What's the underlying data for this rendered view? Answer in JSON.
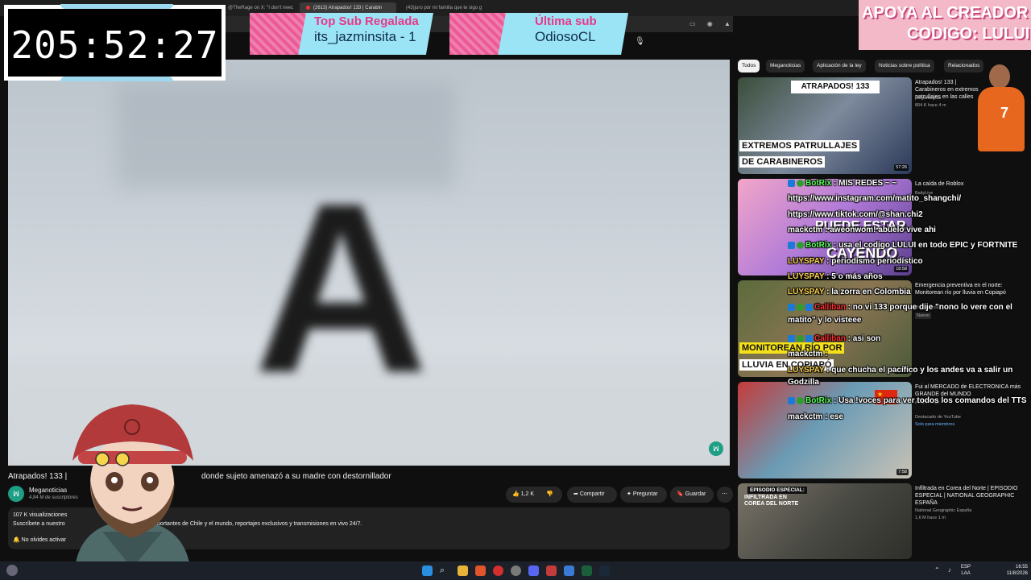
{
  "browser": {
    "tabs": [
      {
        "label": "@TheRage on X: \"I don't neec"
      },
      {
        "label": "(2613) Atrapados! 133 | Carabin"
      },
      {
        "label": "(43)juro por mi familia que te sigo g"
      }
    ]
  },
  "stream_overlay": {
    "timer": "205:52:27",
    "top_sub": {
      "heading": "Top Sub Regalada",
      "value": "its_jazminsita - 1"
    },
    "last_sub": {
      "heading": "Última sub",
      "value": "OdiosoCL"
    },
    "support": {
      "line1": "APOYA AL CREADOR",
      "line2": "CODIGO: LULUI"
    }
  },
  "video": {
    "title_start": "Atrapados! 133 |",
    "title_end": "donde sujeto amenazó a su madre con destornillador",
    "channel": "Meganoticias",
    "subscribers": "4,84 M de suscriptores",
    "likes": "1,2 K",
    "share_label": "Compartir",
    "ask_label": "Preguntar",
    "save_label": "Guardar",
    "views": "107 K visualizaciones",
    "desc_line2a": "Suscríbete a nuestro",
    "desc_line2b": "portantes de Chile y el mundo, reportajes exclusivos y transmisiones en vivo 24/7.",
    "desc_line3": "No olvides activar"
  },
  "chips": [
    "Todos",
    "Meganoticias",
    "Aplicación de la ley",
    "Noticias sobre política",
    "Relacionados"
  ],
  "recommendations": [
    {
      "title": "Atrapados! 133 | Carabineros en extremos patrullajes en las calles",
      "channel": "Meganoticias",
      "meta": "804 K  hace 4 m",
      "duration": "57:26",
      "thumb_text1": "EXTREMOS PATRULLAJES",
      "thumb_text2": "DE CARABINEROS",
      "thumb_badge": "ATRAPADOS! 133"
    },
    {
      "title": "La caída de Roblox",
      "channel": "BaityLive",
      "meta": "",
      "duration": "18:58",
      "thumb_text1": "PUEDE ESTAR",
      "thumb_text2": "CAYENDO"
    },
    {
      "title": "Emergencia preventiva en el norte: Monitorean río por lluvia en Copiapó",
      "channel": "Meganoticias",
      "meta": "Nuevo",
      "duration": "10:22",
      "thumb_text1": "MONITOREAN RÍO POR",
      "thumb_text2": "LLUVIA EN COPIAPÓ"
    },
    {
      "title": "Fui al MERCADO de ELECTRONICA más GRANDE del MUNDO",
      "channel": "Acaya Vlogs",
      "meta": "Destacado de YouTube",
      "meta2": "Solo para miembros",
      "duration": "7:58"
    },
    {
      "title": "Infiltrada en Corea del Norte | EPISODIO ESPECIAL | NATIONAL GEOGRAPHIC ESPAÑA",
      "channel": "National Geographic España",
      "meta": "1,6 M  hace 1 m",
      "thumb_text1": "EPISODIO ESPECIAL:",
      "thumb_text2": "INFILTRADA EN COREA DEL NORTE"
    }
  ],
  "chat": [
    {
      "user": "BotRix",
      "color": "#5cff5c",
      "badges": 2,
      "msg": "MIS REDES ~ ~"
    },
    {
      "user": "",
      "color": "#fff",
      "badges": 0,
      "msg": "https://www.instagram.com/matito_shangchi/"
    },
    {
      "user": "",
      "color": "#fff",
      "badges": 0,
      "msg": "https://www.tiktok.com/@shan.chi2"
    },
    {
      "user": "mackctm",
      "color": "#ffffff",
      "badges": 0,
      "msg": "aweonwom! abuelo vive ahi"
    },
    {
      "user": "BotRix",
      "color": "#5cff5c",
      "badges": 2,
      "msg": "usa el codigo LULUI en todo EPIC y FORTNITE"
    },
    {
      "user": "LUYSPAY",
      "color": "#ffd34d",
      "badges": 0,
      "msg": "periodismo periodístico"
    },
    {
      "user": "LUYSPAY",
      "color": "#ffd34d",
      "badges": 0,
      "msg": "5 o más años"
    },
    {
      "user": "LUYSPAY",
      "color": "#ffd34d",
      "badges": 0,
      "msg": "la zorra en Colombia"
    },
    {
      "user": "Calliban",
      "color": "#ff3030",
      "badges": 3,
      "msg": "no vi 133 porque dije \"nono lo vere con el matito\" y lo visteee"
    },
    {
      "user": "Calliban",
      "color": "#ff3030",
      "badges": 3,
      "msg": "asi son"
    },
    {
      "user": "mackctm",
      "color": "#ffffff",
      "badges": 0,
      "msg": ""
    },
    {
      "user": "LUYSPAY",
      "color": "#ffd34d",
      "badges": 0,
      "msg": "que chucha el pacífico y los andes va a salir un Godzilla"
    },
    {
      "user": "BotRix",
      "color": "#5cff5c",
      "badges": 2,
      "msg": "Usa !voces para ver todos los comandos del TTS"
    },
    {
      "user": "mackctm",
      "color": "#ffffff",
      "badges": 0,
      "msg": "ese"
    }
  ],
  "taskbar": {
    "lang1": "ESP",
    "lang2": "LAA",
    "time": "16:55",
    "date": "11/8/2026"
  },
  "colors": {
    "accent_pink": "#e8388a",
    "overlay_blue": "#9be4f5",
    "youtube_bg": "#0f0f0f"
  }
}
